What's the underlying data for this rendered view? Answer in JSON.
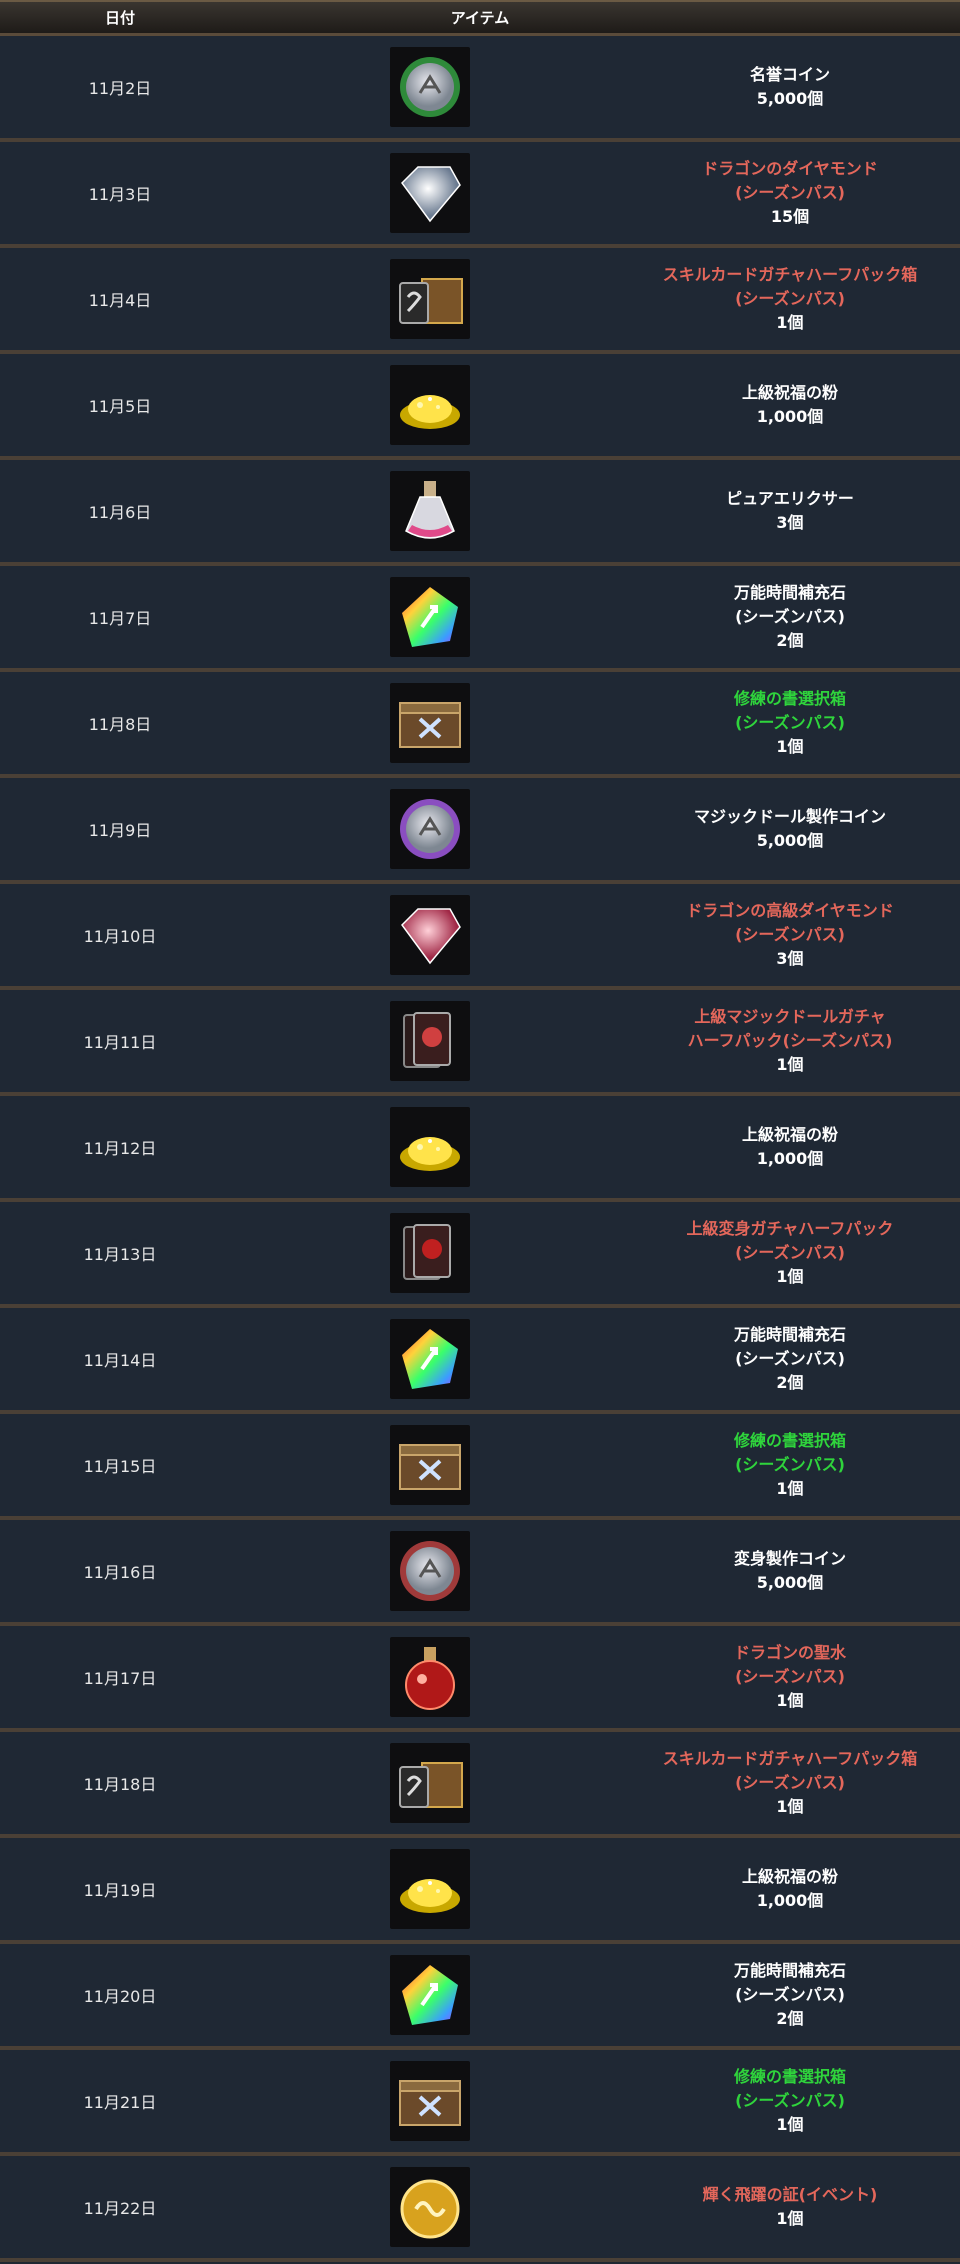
{
  "header": {
    "date": "日付",
    "item": "アイテム"
  },
  "rows": [
    {
      "date": "11月2日",
      "icon": "coin-green-icon",
      "name": [
        "名誉コイン"
      ],
      "color": "white",
      "qty": "5,000個"
    },
    {
      "date": "11月3日",
      "icon": "dragon-diamond-icon",
      "name": [
        "ドラゴンのダイヤモンド",
        "(シーズンパス)"
      ],
      "color": "red",
      "qty": "15個"
    },
    {
      "date": "11月4日",
      "icon": "skill-card-box-icon",
      "name": [
        "スキルカードガチャハーフパック箱",
        "(シーズンパス)"
      ],
      "color": "red",
      "qty": "1個"
    },
    {
      "date": "11月5日",
      "icon": "gold-powder-icon",
      "name": [
        "上級祝福の粉"
      ],
      "color": "white",
      "qty": "1,000個"
    },
    {
      "date": "11月6日",
      "icon": "elixir-flask-icon",
      "name": [
        "ピュアエリクサー"
      ],
      "color": "white",
      "qty": "3個"
    },
    {
      "date": "11月7日",
      "icon": "rainbow-crystal-icon",
      "name": [
        "万能時間補充石",
        "(シーズンパス)"
      ],
      "color": "white",
      "qty": "2個"
    },
    {
      "date": "11月8日",
      "icon": "training-book-box-icon",
      "name": [
        "修練の書選択箱",
        "(シーズンパス)"
      ],
      "color": "green",
      "qty": "1個"
    },
    {
      "date": "11月9日",
      "icon": "coin-purple-icon",
      "name": [
        "マジックドール製作コイン"
      ],
      "color": "white",
      "qty": "5,000個"
    },
    {
      "date": "11月10日",
      "icon": "dragon-high-diamond-icon",
      "name": [
        "ドラゴンの高級ダイヤモンド",
        "(シーズンパス)"
      ],
      "color": "red",
      "qty": "3個"
    },
    {
      "date": "11月11日",
      "icon": "magic-doll-cards-icon",
      "name": [
        "上級マジックドールガチャ",
        "ハーフパック(シーズンパス)"
      ],
      "color": "red",
      "qty": "1個"
    },
    {
      "date": "11月12日",
      "icon": "gold-powder-icon",
      "name": [
        "上級祝福の粉"
      ],
      "color": "white",
      "qty": "1,000個"
    },
    {
      "date": "11月13日",
      "icon": "transform-cards-icon",
      "name": [
        "上級変身ガチャハーフパック",
        "(シーズンパス)"
      ],
      "color": "red",
      "qty": "1個"
    },
    {
      "date": "11月14日",
      "icon": "rainbow-crystal-icon",
      "name": [
        "万能時間補充石",
        "(シーズンパス)"
      ],
      "color": "white",
      "qty": "2個"
    },
    {
      "date": "11月15日",
      "icon": "training-book-box-icon",
      "name": [
        "修練の書選択箱",
        "(シーズンパス)"
      ],
      "color": "green",
      "qty": "1個"
    },
    {
      "date": "11月16日",
      "icon": "coin-red-icon",
      "name": [
        "変身製作コイン"
      ],
      "color": "white",
      "qty": "5,000個"
    },
    {
      "date": "11月17日",
      "icon": "dragon-holy-water-icon",
      "name": [
        "ドラゴンの聖水",
        "(シーズンパス)"
      ],
      "color": "red",
      "qty": "1個"
    },
    {
      "date": "11月18日",
      "icon": "skill-card-box-icon",
      "name": [
        "スキルカードガチャハーフパック箱",
        "(シーズンパス)"
      ],
      "color": "red",
      "qty": "1個"
    },
    {
      "date": "11月19日",
      "icon": "gold-powder-icon",
      "name": [
        "上級祝福の粉"
      ],
      "color": "white",
      "qty": "1,000個"
    },
    {
      "date": "11月20日",
      "icon": "rainbow-crystal-icon",
      "name": [
        "万能時間補充石",
        "(シーズンパス)"
      ],
      "color": "white",
      "qty": "2個"
    },
    {
      "date": "11月21日",
      "icon": "training-book-box-icon",
      "name": [
        "修練の書選択箱",
        "(シーズンパス)"
      ],
      "color": "green",
      "qty": "1個"
    },
    {
      "date": "11月22日",
      "icon": "gold-medal-icon",
      "name": [
        "輝く飛躍の証(イベント)"
      ],
      "color": "red",
      "qty": "1個"
    }
  ]
}
